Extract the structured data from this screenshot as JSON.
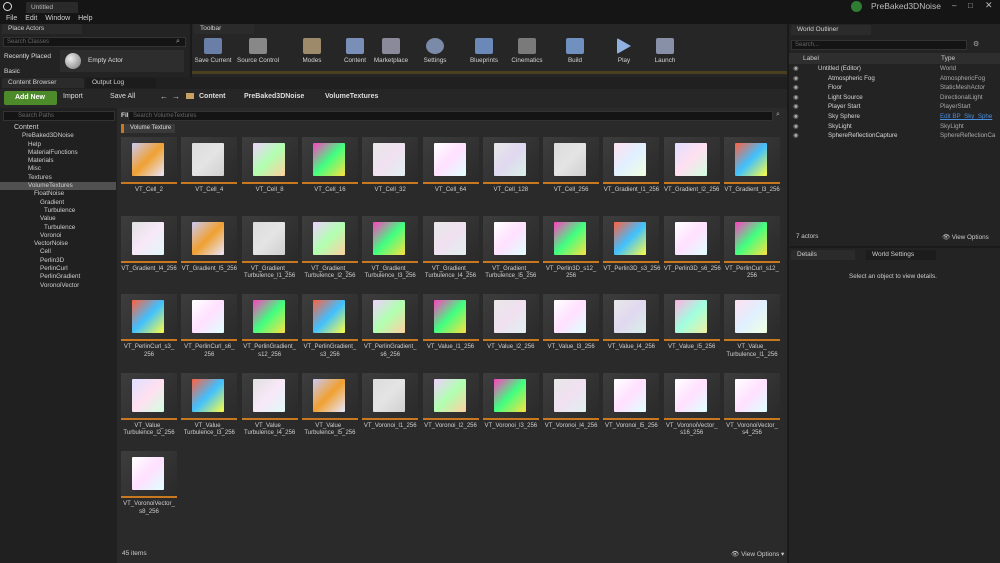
{
  "window": {
    "tab": "Untitled",
    "project": "PreBaked3DNoise"
  },
  "menu": [
    "File",
    "Edit",
    "Window",
    "Help"
  ],
  "place_actors": {
    "tab": "Place Actors",
    "search_placeholder": "Search Classes",
    "recently_placed": "Recently Placed",
    "basic": "Basic",
    "empty_actor": "Empty Actor"
  },
  "toolbar": {
    "tab": "Toolbar",
    "buttons": [
      "Save Current",
      "Source Control",
      "Modes",
      "Content",
      "Marketplace",
      "Settings",
      "Blueprints",
      "Cinematics",
      "Build",
      "Play",
      "Launch"
    ]
  },
  "content_browser": {
    "tab": "Content Browser",
    "output_tab": "Output Log",
    "add_new": "Add New",
    "import": "Import",
    "save_all": "Save All",
    "breadcrumb": [
      "Content",
      "PreBaked3DNoise",
      "VolumeTextures"
    ],
    "filters": "Filters",
    "search_placeholder": "Search VolumeTextures",
    "filter_chip": "Volume Texture",
    "search_paths": "Search Paths",
    "items_count": "45 items",
    "view_options": "View Options"
  },
  "tree": [
    "Content",
    "PreBaked3DNoise",
    "Help",
    "MaterialFunctions",
    "Materials",
    "Misc",
    "Textures",
    "VolumeTextures",
    "FloatNoise",
    "Gradient",
    "Turbulence",
    "Value",
    "Turbulence",
    "Voronoi",
    "VectorNoise",
    "Cell",
    "Perlin3D",
    "PerlinCurl",
    "PerlinGradient",
    "VoronoiVector"
  ],
  "assets": [
    "VT_Cell_2",
    "VT_Cell_4",
    "VT_Cell_8",
    "VT_Cell_16",
    "VT_Cell_32",
    "VT_Cell_64",
    "VT_Cell_128",
    "VT_Cell_256",
    "VT_Gradient_l1_256",
    "VT_Gradient_l2_256",
    "VT_Gradient_l3_256",
    "VT_Gradient_l4_256",
    "VT_Gradient_l5_256",
    "VT_Gradient_\nTurbulence_l1_256",
    "VT_Gradient_\nTurbulence_l2_256",
    "VT_Gradient_\nTurbulence_l3_256",
    "VT_Gradient_\nTurbulence_l4_256",
    "VT_Gradient_\nTurbulence_l5_256",
    "VT_Perlin3D_s12_\n256",
    "VT_Perlin3D_s3_256",
    "VT_Perlin3D_s6_256",
    "VT_PerlinCurl_s12_\n256",
    "VT_PerlinCurl_s3_\n256",
    "VT_PerlinCurl_s6_\n256",
    "VT_PerlinGradient_\ns12_256",
    "VT_PerlinGradient_\ns3_256",
    "VT_PerlinGradient_\ns6_256",
    "VT_Value_l1_256",
    "VT_Value_l2_256",
    "VT_Value_l3_256",
    "VT_Value_l4_256",
    "VT_Value_l5_256",
    "VT_Value_\nTurbulence_l1_256",
    "VT_Value_\nTurbulence_l2_256",
    "VT_Value_\nTurbulence_l3_256",
    "VT_Value_\nTurbulence_l4_256",
    "VT_Value_\nTurbulence_l5_256",
    "VT_Voronoi_l1_256",
    "VT_Voronoi_l2_256",
    "VT_Voronoi_l3_256",
    "VT_Voronoi_l4_256",
    "VT_Voronoi_l5_256",
    "VT_VoronoiVector_\ns16_256",
    "VT_VoronoiVector_\ns4_256",
    "VT_VoronoiVector_\ns8_256"
  ],
  "outliner": {
    "tab": "World Outliner",
    "search_placeholder": "Search...",
    "col_label": "Label",
    "col_type": "Type",
    "rows": [
      [
        "Untitled (Editor)",
        "World"
      ],
      [
        "Atmospheric Fog",
        "AtmosphericFog"
      ],
      [
        "Floor",
        "StaticMeshActor"
      ],
      [
        "Light Source",
        "DirectionalLight"
      ],
      [
        "Player Start",
        "PlayerStart"
      ],
      [
        "Sky Sphere",
        "Edit BP_Sky_Sphe"
      ],
      [
        "SkyLight",
        "SkyLight"
      ],
      [
        "SphereReflectionCapture",
        "SphereReflectionCa"
      ]
    ],
    "actors": "7 actors",
    "view_options": "View Options"
  },
  "details": {
    "tab": "Details",
    "world_tab": "World Settings",
    "hint": "Select an object to view details."
  },
  "colors": {
    "accent_green": "#4c8a2a",
    "thumb_border": "#c8781e",
    "link": "#4a8fe0"
  }
}
